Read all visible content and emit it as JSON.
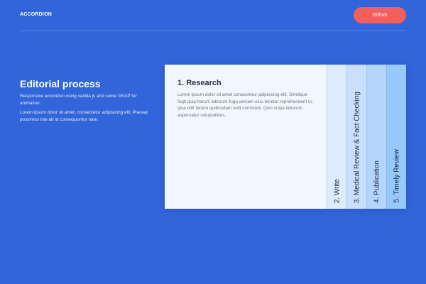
{
  "header": {
    "brand": "ACCORDION",
    "github_label": "Github"
  },
  "intro": {
    "title": "Editorial process",
    "paragraphs": [
      "Responsive accordion using vanilla js and some GSAP for animation.",
      "Lorem ipsum dolor sit amet, consectetur adipisicing elit. Placeat possimus iste ab id consequuntur nam."
    ]
  },
  "accordion": {
    "open": {
      "title": "1. Research",
      "body": "Lorem ipsum dolor sit amet consectetur adipisicing elit. Similique fugit quia harum laborum fuga veniam eius tenetur reprehenderit in, ipsa odit facere quibusdam velit commodi. Quis culpa laborum aspernatur voluptatibus."
    },
    "tabs": [
      {
        "label": "2. Write",
        "color": "#dcebfd"
      },
      {
        "label": "3. Medical Review & Fact Checking",
        "color": "#c8e0fd"
      },
      {
        "label": "4. Publication",
        "color": "#b4d6fd"
      },
      {
        "label": "5. Timely Review",
        "color": "#98c9fd"
      }
    ]
  },
  "colors": {
    "background": "#3265d9",
    "button": "#f25f5c"
  }
}
